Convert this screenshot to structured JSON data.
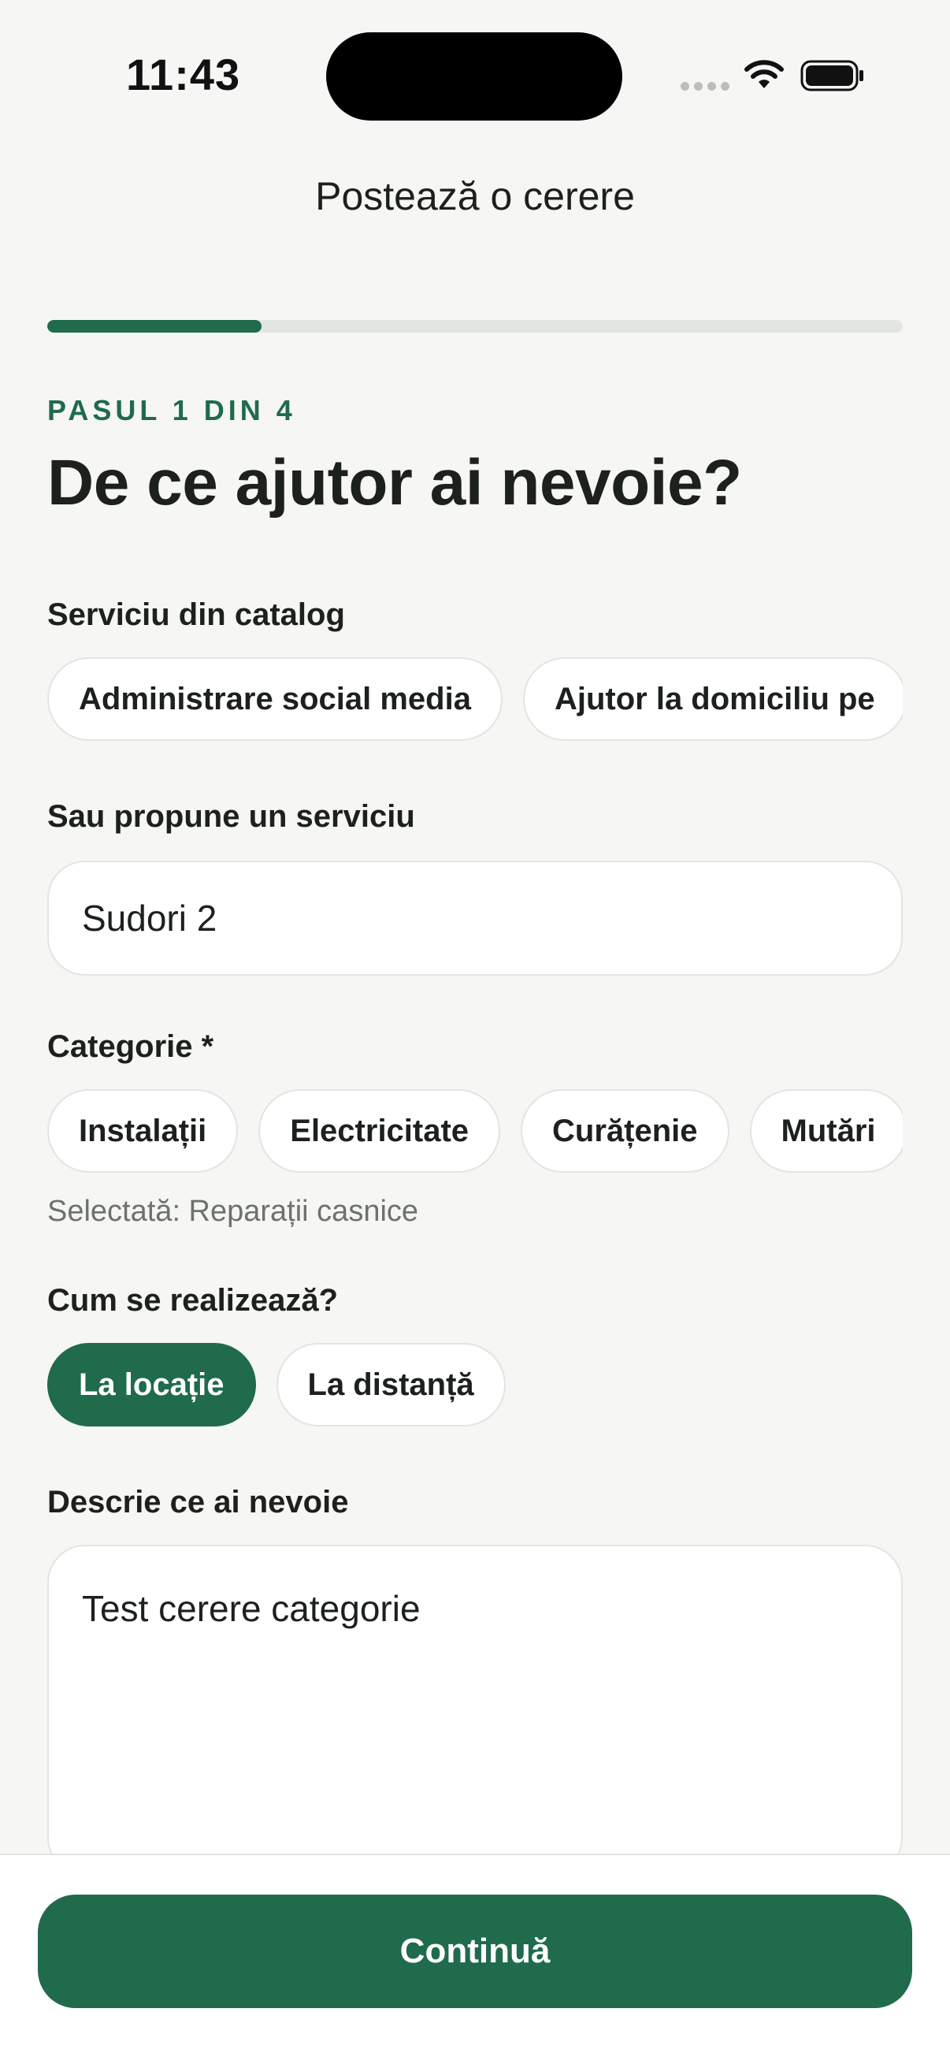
{
  "status_bar": {
    "time": "11:43",
    "signal_icon": "signal-dots-icon",
    "wifi_icon": "wifi-icon",
    "battery_icon": "battery-icon"
  },
  "header": {
    "title": "Postează o cerere"
  },
  "progress": {
    "current_step": 1,
    "total_steps": 4,
    "fraction": 0.25,
    "color": "#1f6b4c"
  },
  "step": {
    "label": "PASUL 1 DIN 4",
    "title": "De ce ajutor ai nevoie?"
  },
  "catalog": {
    "label": "Serviciu din catalog",
    "services": [
      "Administrare social media",
      "Ajutor la domiciliu pe"
    ]
  },
  "custom_service": {
    "label": "Sau propune un serviciu",
    "value": "Sudori 2"
  },
  "category": {
    "label": "Categorie *",
    "options": [
      "Instalații",
      "Electricitate",
      "Curățenie",
      "Mutări"
    ],
    "selected_text": "Selectată: Reparații casnice"
  },
  "mode": {
    "label": "Cum se realizează?",
    "options": [
      "La locație",
      "La distanță"
    ],
    "selected": "La locație"
  },
  "description": {
    "label": "Descrie ce ai nevoie",
    "value": "Test cerere categorie"
  },
  "footer": {
    "continue_label": "Continuă"
  },
  "colors": {
    "accent": "#1f6b4c",
    "background": "#f6f6f4",
    "text": "#1c211e"
  }
}
